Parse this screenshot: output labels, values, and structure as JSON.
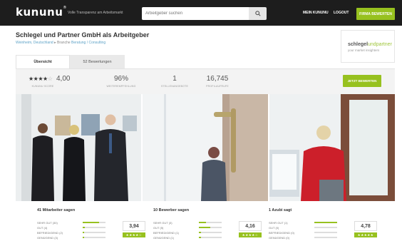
{
  "header": {
    "logo": "kununu",
    "logo_sup": "®",
    "tagline": "Volle Transparenz am Arbeitsmarkt",
    "search_placeholder": "Arbeitgeber suchen",
    "search_icon": "search-icon",
    "nav": [
      "MEIN KUNUNU",
      "LOGOUT"
    ],
    "cta": "FIRMA BEWERTEN",
    "accent": "#97c11f",
    "bg": "#1d1d1d"
  },
  "company": {
    "title": "Schlegel und Partner GmbH als Arbeitgeber",
    "location": "Weinheim, Deutschland",
    "branche_label": "Branche",
    "branche": "Beratung / Consulting",
    "logo_main": "schlegel",
    "logo_accent": "undpartner",
    "logo_sub": "your market insighters"
  },
  "tabs": [
    "Übersicht",
    "52 Bewertungen"
  ],
  "stats": {
    "stars": "★★★★",
    "stars_empty": "☆",
    "score": "4,00",
    "score_label": "KUNUNU SCORE",
    "recommend": "96%",
    "recommend_label": "WEITEREMPFEHLUNG",
    "jobs": "1",
    "jobs_label": "STELLENANGEBOTE",
    "views": "16,745",
    "views_label": "PROFILAUFRUFE",
    "cta": "JETZT BEWERTEN"
  },
  "cards": [
    {
      "title": "41 Mitarbeiter sagen",
      "rows": [
        {
          "label": "SEHR GUT (30)",
          "fill": 0.73
        },
        {
          "label": "GUT (4)",
          "fill": 0.1
        },
        {
          "label": "BEFRIEDIGEND (2)",
          "fill": 0.05
        },
        {
          "label": "GENÜGEND (3)",
          "fill": 0.07
        }
      ],
      "score": "3,94",
      "stars": "★★★★☆"
    },
    {
      "title": "10 Bewerber sagen",
      "rows": [
        {
          "label": "SEHR GUT (3)",
          "fill": 0.3
        },
        {
          "label": "GUT (5)",
          "fill": 0.5
        },
        {
          "label": "BEFRIEDIGEND (1)",
          "fill": 0.1
        },
        {
          "label": "GENÜGEND (1)",
          "fill": 0.1
        }
      ],
      "score": "4,16",
      "stars": "★★★★☆"
    },
    {
      "title": "1 Azubi sagt",
      "rows": [
        {
          "label": "SEHR GUT (1)",
          "fill": 1.0
        },
        {
          "label": "GUT (0)",
          "fill": 0
        },
        {
          "label": "BEFRIEDIGEND (0)",
          "fill": 0
        },
        {
          "label": "GENÜGEND (0)",
          "fill": 0
        }
      ],
      "score": "4,78",
      "stars": "★★★★★"
    }
  ]
}
